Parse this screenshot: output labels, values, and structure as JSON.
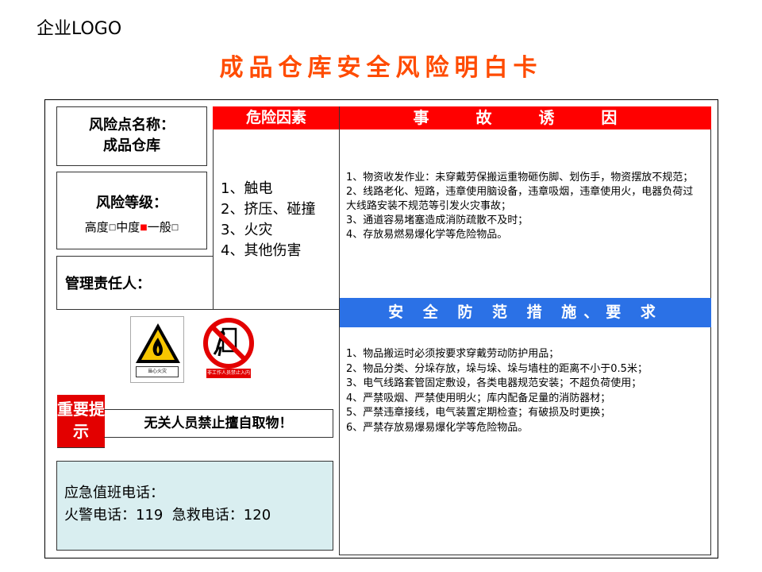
{
  "header": {
    "logo": "企业LOGO",
    "title": "成品仓库安全风险明白卡"
  },
  "risk_point": {
    "label": "风险点名称：",
    "value": "成品仓库"
  },
  "risk_level": {
    "label": "风险等级：",
    "options": [
      {
        "label": "高度",
        "checked": false
      },
      {
        "label": "中度",
        "checked": true
      },
      {
        "label": "一般",
        "checked": false
      }
    ],
    "marker_color": "#ff0000"
  },
  "manager": {
    "label": "管理责任人："
  },
  "hazards": {
    "header": "危险因素",
    "items": [
      "1、触电",
      "2、挤压、碰撞",
      "3、火灾",
      "4、其他伤害"
    ]
  },
  "accident_causes": {
    "header": "事 故 诱 因",
    "items": [
      "1、物资收发作业：未穿戴劳保搬运重物砸伤脚、划伤手，物资摆放不规范；",
      "2、线路老化、短路，违章使用脑设备，违章吸烟，违章使用火，电器负荷过大线路安装不规范等引发火灾事故；",
      "3、通道容易堵塞造成消防疏散不及时；",
      "4、存放易燃易爆化学等危险物品。"
    ]
  },
  "measures": {
    "header": "安 全 防 范 措 施、要 求",
    "items": [
      "1、物品搬运时必须按要求穿戴劳动防护用品；",
      "2、物品分类、分垛存放，垛与垛、垛与墙柱的距离不小于0.5米；",
      "3、电气线路套管固定敷设，各类电器规范安装；不超负荷使用；",
      "4、严禁吸烟、严禁使用明火；库内配备足量的消防器材；",
      "5、严禁违章接线，电气装置定期检查；有破损及时更换；",
      "6、严禁存放易爆易爆化学等危险物品。"
    ]
  },
  "signs": [
    {
      "icon": "fire-warning-icon",
      "caption": "当心火灾"
    },
    {
      "icon": "no-entry-icon",
      "caption": "非工作人员禁止入内"
    }
  ],
  "tip": {
    "badge": "重要提示",
    "text": "无关人员禁止擅自取物！"
  },
  "emergency": {
    "line1": "应急值班电话：",
    "line2": "火警电话：119  急救电话：120"
  },
  "colors": {
    "title": "#ff4b00",
    "header_red": "#ff0000",
    "header_blue": "#2b71e6",
    "phone_bg": "#d9eef0"
  }
}
